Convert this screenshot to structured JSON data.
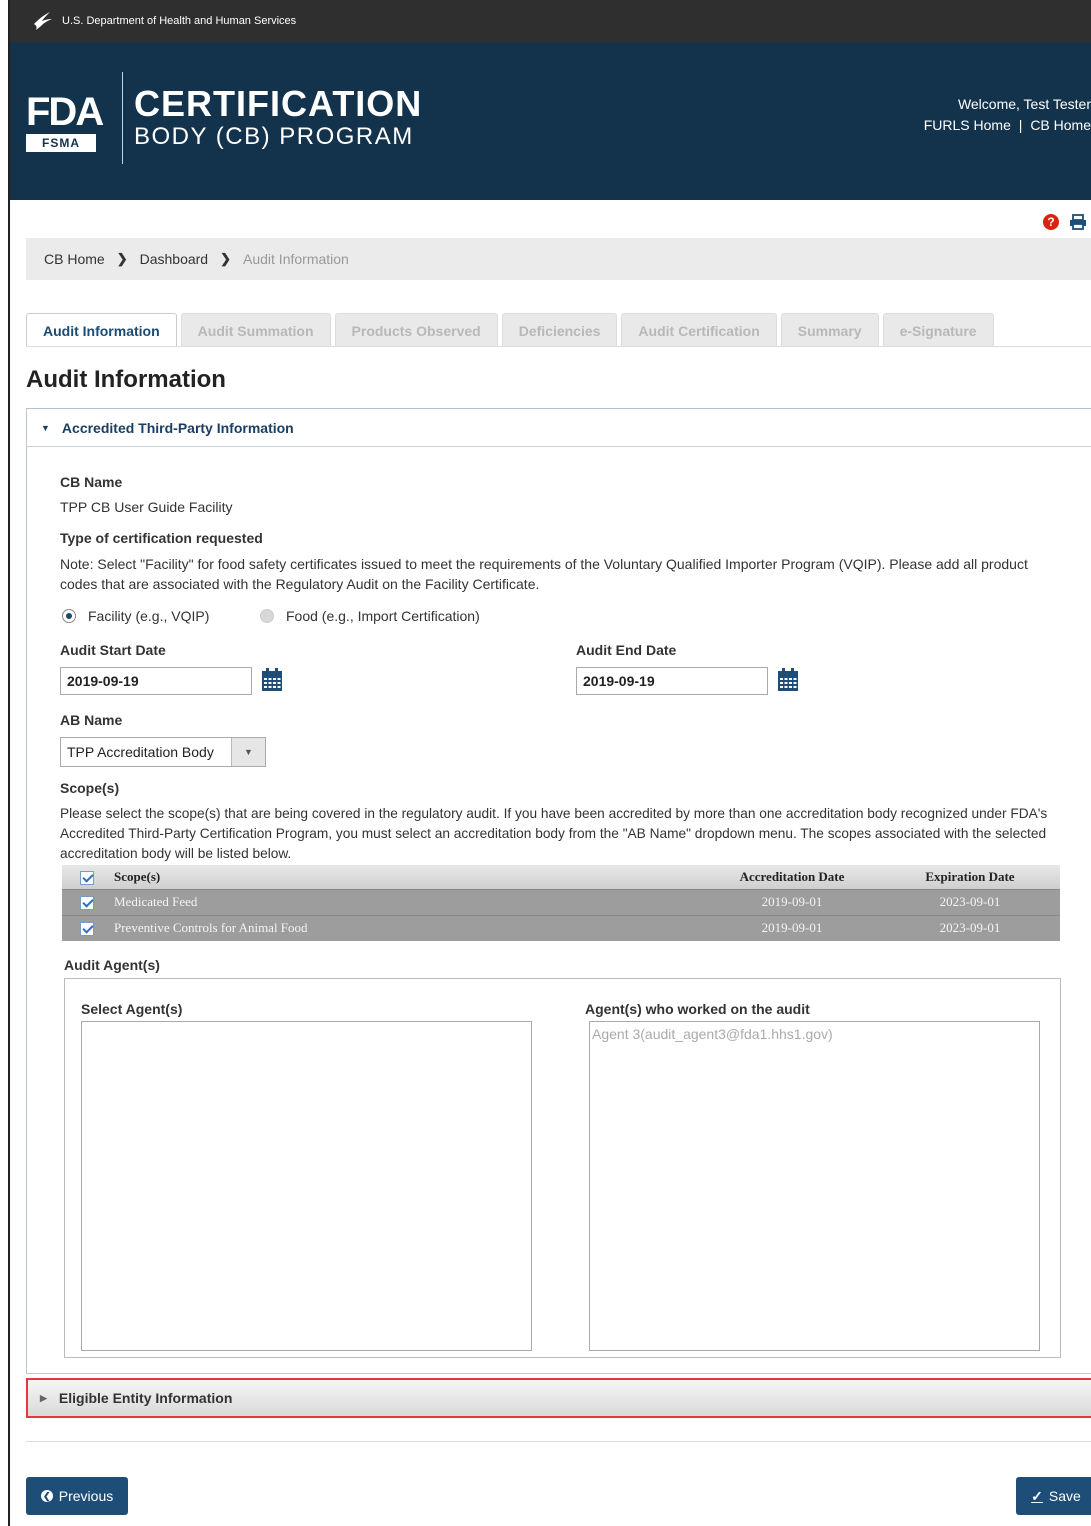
{
  "gov_bar": {
    "text": "U.S. Department of Health and Human Services",
    "icon": "hhs-eagle-icon"
  },
  "header": {
    "logo_fda": "FDA",
    "logo_fsma": "FSMA",
    "title_line1": "CERTIFICATION",
    "title_line2": "BODY (CB) PROGRAM",
    "welcome": "Welcome, Test Tester",
    "link_furls": "FURLS Home",
    "link_separator": "|",
    "link_cb": "CB Home",
    "background_color": "#13334c"
  },
  "utility": {
    "help_icon": "help-icon",
    "help_glyph": "?",
    "print_icon": "print-icon"
  },
  "breadcrumb": {
    "items": [
      "CB Home",
      "Dashboard",
      "Audit Information"
    ],
    "separator": "❯"
  },
  "tabs": [
    {
      "label": "Audit Information",
      "active": true
    },
    {
      "label": "Audit Summation",
      "active": false
    },
    {
      "label": "Products Observed",
      "active": false
    },
    {
      "label": "Deficiencies",
      "active": false
    },
    {
      "label": "Audit Certification",
      "active": false
    },
    {
      "label": "Summary",
      "active": false
    },
    {
      "label": "e-Signature",
      "active": false
    }
  ],
  "page_title": "Audit Information",
  "accredited_panel": {
    "header": "Accredited Third-Party Information",
    "caret": "▼",
    "cb_name_label": "CB Name",
    "cb_name_value": "TPP CB User Guide Facility",
    "cert_type_label": "Type of certification requested",
    "cert_type_note": "Note: Select \"Facility\" for food safety certificates issued to meet the requirements of the Voluntary Qualified Importer Program (VQIP). Please add all product codes that are associated with the Regulatory Audit on the Facility Certificate.",
    "radio_facility": "Facility (e.g., VQIP)",
    "radio_food": "Food (e.g., Import Certification)",
    "selected_radio": "Facility (e.g., VQIP)",
    "audit_start_label": "Audit Start Date",
    "audit_start_value": "2019-09-19",
    "audit_end_label": "Audit End Date",
    "audit_end_value": "2019-09-19",
    "ab_name_label": "AB Name",
    "ab_name_value": "TPP Accreditation Body",
    "ab_name_caret": "▼",
    "scopes_label": "Scope(s)",
    "scopes_note": "Please select the scope(s) that are being covered in the regulatory audit. If you have been accredited by more than one accreditation body recognized under FDA's Accredited Third-Party Certification Program, you must select an accreditation body from the \"AB Name\" dropdown menu. The scopes associated with the selected accreditation body will be listed below.",
    "scope_table": {
      "headers": [
        "Scope(s)",
        "Accreditation Date",
        "Expiration Date"
      ],
      "rows": [
        {
          "scope": "Medicated Feed",
          "accreditation_date": "2019-09-01",
          "expiration_date": "2023-09-01",
          "checked": true
        },
        {
          "scope": "Preventive Controls for Animal Food",
          "accreditation_date": "2019-09-01",
          "expiration_date": "2023-09-01",
          "checked": true
        }
      ]
    },
    "audit_agents_label": "Audit Agent(s)",
    "select_agents_label": "Select Agent(s)",
    "selected_agents_label": "Agent(s) who worked on the audit",
    "available_agents": [],
    "selected_agents": [
      "Agent 3(audit_agent3@fda1.hhs1.gov)"
    ],
    "move_buttons": [
      "→",
      "⇥",
      "←",
      "⇤"
    ]
  },
  "eligible_panel": {
    "header": "Eligible Entity Information",
    "caret": "▶"
  },
  "footer": {
    "previous_label": "Previous",
    "previous_glyph": "❮",
    "save_label": "Save",
    "save_glyph": "✓"
  }
}
